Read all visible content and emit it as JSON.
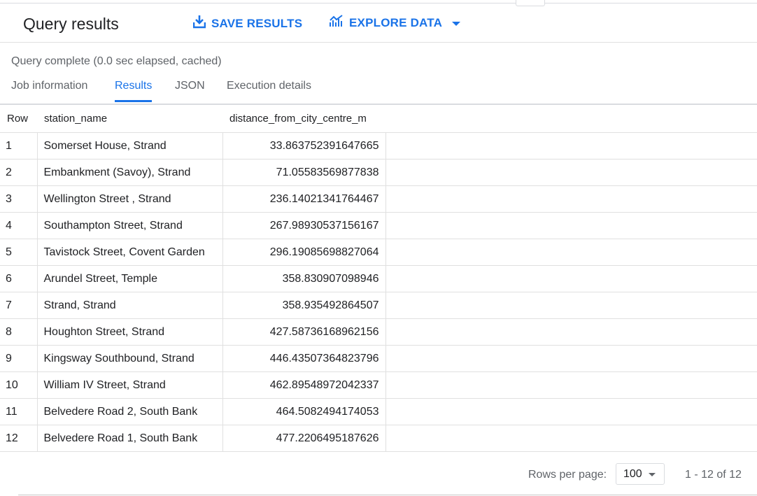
{
  "header": {
    "title": "Query results",
    "save_label": "SAVE RESULTS",
    "explore_label": "EXPLORE DATA",
    "accent_color": "#1a73e8"
  },
  "status": "Query complete (0.0 sec elapsed, cached)",
  "tabs": [
    {
      "label": "Job information"
    },
    {
      "label": "Results"
    },
    {
      "label": "JSON"
    },
    {
      "label": "Execution details"
    }
  ],
  "active_tab": "Results",
  "table": {
    "columns": [
      "Row",
      "station_name",
      "distance_from_city_centre_m"
    ],
    "rows": [
      {
        "row": "1",
        "station_name": "Somerset House, Strand",
        "distance": "33.863752391647665"
      },
      {
        "row": "2",
        "station_name": "Embankment (Savoy), Strand",
        "distance": "71.05583569877838"
      },
      {
        "row": "3",
        "station_name": "Wellington Street , Strand",
        "distance": "236.14021341764467"
      },
      {
        "row": "4",
        "station_name": "Southampton Street, Strand",
        "distance": "267.98930537156167"
      },
      {
        "row": "5",
        "station_name": "Tavistock Street, Covent Garden",
        "distance": "296.19085698827064"
      },
      {
        "row": "6",
        "station_name": "Arundel Street, Temple",
        "distance": "358.830907098946"
      },
      {
        "row": "7",
        "station_name": "Strand, Strand",
        "distance": "358.935492864507"
      },
      {
        "row": "8",
        "station_name": "Houghton Street, Strand",
        "distance": "427.58736168962156"
      },
      {
        "row": "9",
        "station_name": "Kingsway Southbound, Strand",
        "distance": "446.43507364823796"
      },
      {
        "row": "10",
        "station_name": "William IV Street, Strand",
        "distance": "462.89548972042337"
      },
      {
        "row": "11",
        "station_name": "Belvedere Road 2, South Bank",
        "distance": "464.5082494174053"
      },
      {
        "row": "12",
        "station_name": "Belvedere Road 1, South Bank",
        "distance": "477.2206495187626"
      }
    ]
  },
  "pagination": {
    "rows_per_page_label": "Rows per page:",
    "rows_per_page_value": "100",
    "range": "1 - 12 of 12"
  },
  "icons": {
    "save": "download-icon",
    "explore": "chart-icon",
    "explore_menu": "caret-down-icon",
    "rpp_menu": "caret-down-icon"
  }
}
